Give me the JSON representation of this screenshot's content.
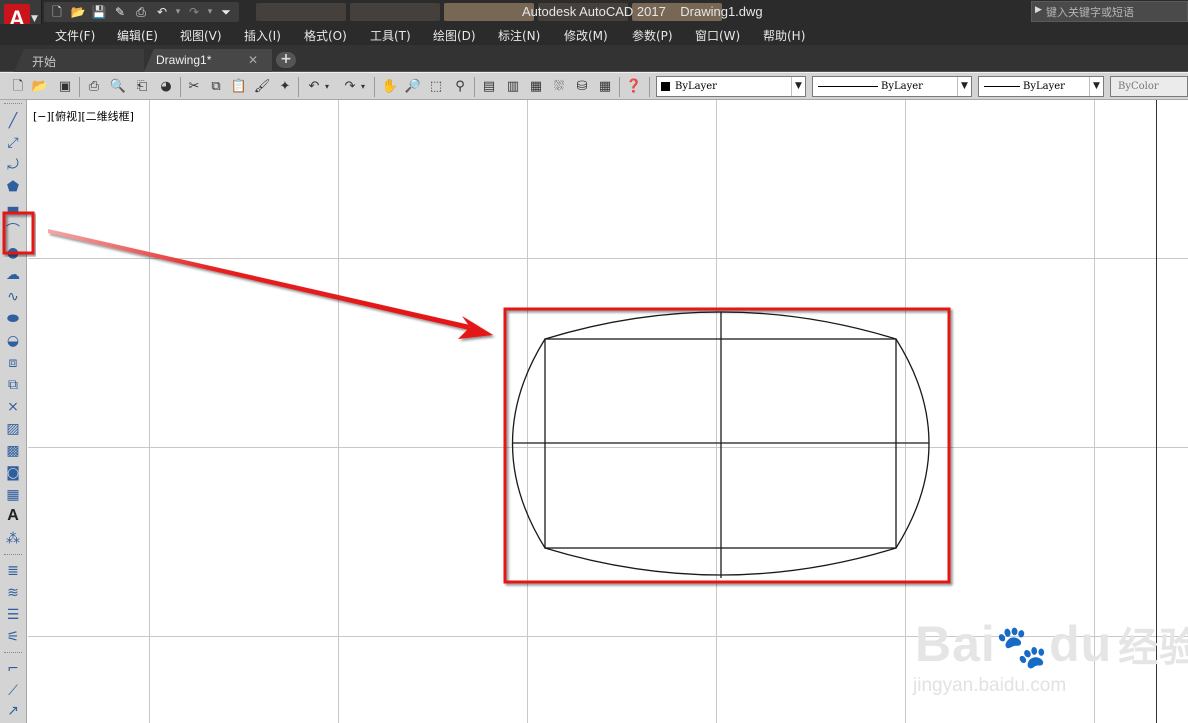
{
  "title_bar": {
    "app_logo": "A",
    "title": "Autodesk AutoCAD 2017    Drawing1.dwg",
    "search_placeholder": "键入关键字或短语",
    "quick_access_icons": [
      "new-icon",
      "open-icon",
      "save-icon",
      "save-as-icon",
      "print-icon",
      "undo-icon",
      "redo-icon",
      "customize-icon"
    ]
  },
  "menu": [
    "文件(F)",
    "编辑(E)",
    "视图(V)",
    "插入(I)",
    "格式(O)",
    "工具(T)",
    "绘图(D)",
    "标注(N)",
    "修改(M)",
    "参数(P)",
    "窗口(W)",
    "帮助(H)"
  ],
  "tabs": {
    "start": "开始",
    "drawing": "Drawing1*",
    "close_glyph": "✕",
    "add_glyph": "+"
  },
  "toolbar": {
    "color_combo": "ByLayer",
    "linetype_combo": "ByLayer",
    "lineweight_combo": "ByLayer",
    "plotstyle_combo": "ByColor"
  },
  "viewport": {
    "label": "[−][俯视][二维线框]"
  },
  "watermark": {
    "brand": "Bai",
    "brand2": "du",
    "brand_cn": "经验",
    "site": "jingyan.baidu.com"
  },
  "colors": {
    "annotation_red": "#e41414",
    "dark_ui": "#2b2b2b",
    "toolbar_gray": "#d4d4d4",
    "grid_line": "#c8c8c8"
  }
}
